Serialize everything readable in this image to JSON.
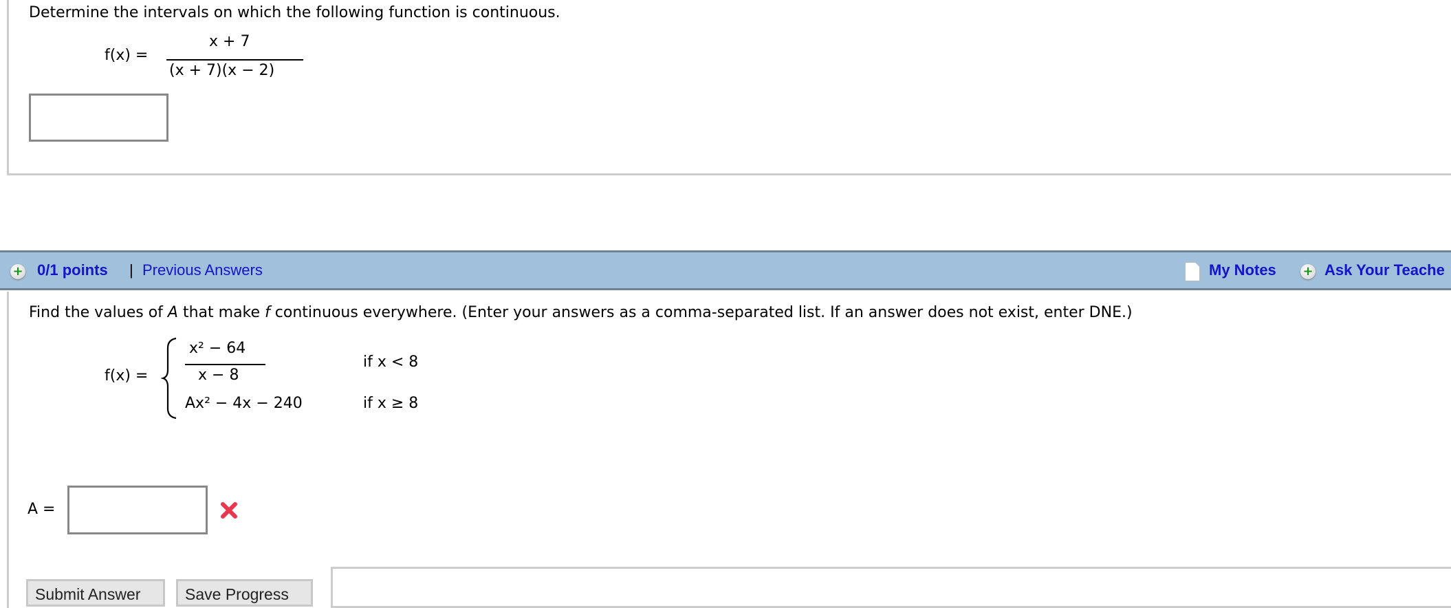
{
  "question1": {
    "prompt": "Determine the intervals on which the following function is continuous.",
    "function_label": "f(x) =",
    "numerator": "x + 7",
    "denominator": "(x + 7)(x − 2)",
    "answer_value": ""
  },
  "question2_header": {
    "points": "0/1 points",
    "separator": "|",
    "previous_answers": "Previous Answers",
    "my_notes": "My Notes",
    "ask_teacher": "Ask Your Teache",
    "band_color": "#a0c0dc",
    "link_color": "#1414c8"
  },
  "question2": {
    "prompt_before_A": "Find the values of ",
    "var_A": "A",
    "prompt_middle": " that make ",
    "var_f": "f",
    "prompt_after": " continuous everywhere. (Enter your answers as a comma-separated list. If an answer does not exist, enter DNE.)",
    "function_label": "f(x) =",
    "piece1_numerator": "x² − 64",
    "piece1_denominator": "x − 8",
    "piece1_condition": "if x < 8",
    "piece2_expression": "Ax² − 4x − 240",
    "piece2_condition": "if x ≥ 8",
    "answer_label": "A =",
    "answer_value": "",
    "answer_status": "incorrect",
    "incorrect_color": "#e8384f"
  },
  "actions": {
    "submit": "Submit Answer",
    "save": "Save Progress"
  }
}
